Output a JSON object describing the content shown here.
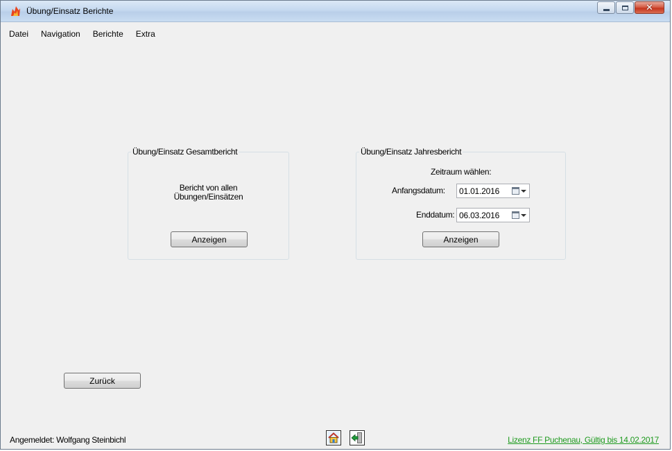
{
  "window": {
    "title": "Übung/Einsatz Berichte"
  },
  "menu": [
    "Datei",
    "Navigation",
    "Berichte",
    "Extra"
  ],
  "gesamtbericht": {
    "legend": "Übung/Einsatz Gesamtbericht",
    "description_line1": "Bericht von allen",
    "description_line2": "Übungen/Einsätzen",
    "button": "Anzeigen"
  },
  "jahresbericht": {
    "legend": "Übung/Einsatz Jahresbericht",
    "heading": "Zeitraum wählen:",
    "start_label": "Anfangsdatum:",
    "start_value": "01.01.2016",
    "end_label": "Enddatum:",
    "end_value": "06.03.2016",
    "button": "Anzeigen"
  },
  "back_button": "Zurück",
  "status": {
    "logged_in": "Angemeldet: Wolfgang Steinbichl",
    "license": "Lizenz FF Puchenau, Gültig bis 14.02.2017"
  },
  "icons": {
    "home": "home-icon",
    "logout": "exit-door-icon"
  },
  "colors": {
    "license_link": "#1e9a1e",
    "window_bg": "#f0f0f0"
  }
}
